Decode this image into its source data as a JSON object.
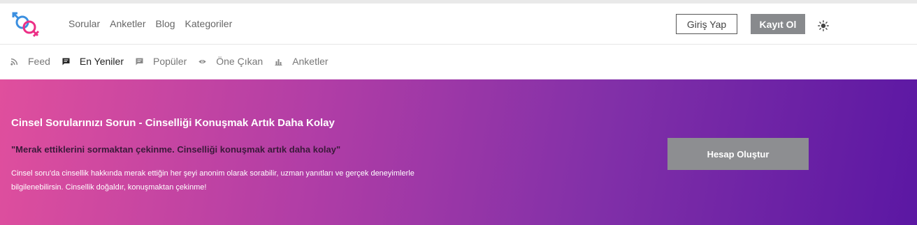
{
  "header": {
    "nav": [
      "Sorular",
      "Anketler",
      "Blog",
      "Kategoriler"
    ],
    "login_label": "Giriş Yap",
    "register_label": "Kayıt Ol"
  },
  "subnav": [
    {
      "label": "Feed",
      "icon": "rss-icon",
      "active": false
    },
    {
      "label": "En Yeniler",
      "icon": "chat-bubble-icon",
      "active": true
    },
    {
      "label": "Popüler",
      "icon": "message-icon",
      "active": false
    },
    {
      "label": "Öne Çıkan",
      "icon": "eye-icon",
      "active": false
    },
    {
      "label": "Anketler",
      "icon": "bar-chart-icon",
      "active": false
    }
  ],
  "hero": {
    "title": "Cinsel Sorularınızı Sorun - Cinselliği Konuşmak Artık Daha Kolay",
    "quote": "\"Merak ettiklerini sormaktan çekinme. Cinselliği konuşmak artık daha kolay\"",
    "description": "Cinsel soru'da cinsellik hakkında merak ettiğin her şeyi anonim olarak sorabilir, uzman yanıtları ve gerçek deneyimlerle bilgilenebilirsin. Cinsellik doğaldır, konuşmaktan çekinme!",
    "cta_label": "Hesap Oluştur"
  },
  "colors": {
    "logo_blue": "#3b8fe0",
    "logo_pink": "#ec2f86",
    "gradient_start": "#e04f9d",
    "gradient_end": "#5b17a3"
  }
}
